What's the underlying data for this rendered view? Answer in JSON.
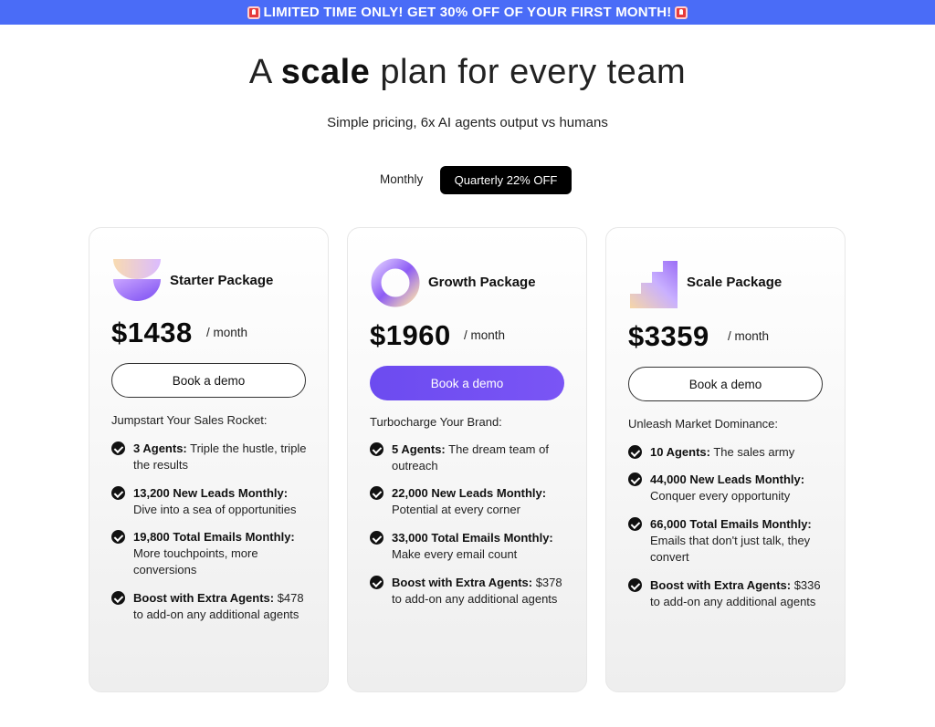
{
  "banner": {
    "text": "LIMITED TIME ONLY! GET 30% OFF OF YOUR FIRST MONTH!",
    "icon": "siren-icon",
    "background": "#4a6cf7"
  },
  "hero": {
    "title_prefix": "A ",
    "title_bold": "scale",
    "title_suffix": " plan for every team",
    "subtitle": "Simple pricing, 6x AI agents output vs humans"
  },
  "billing_toggle": {
    "monthly_label": "Monthly",
    "quarterly_label": "Quarterly 22% OFF",
    "selected": "quarterly"
  },
  "plans": [
    {
      "name": "Starter Package",
      "price": "$1438",
      "period": "/ month",
      "cta": "Book a demo",
      "tagline": "Jumpstart Your Sales Rocket:",
      "features": [
        {
          "bold": "3 Agents:",
          "text": " Triple the hustle, triple the results"
        },
        {
          "bold": "13,200 New Leads Monthly:",
          "text": " Dive into a sea of opportunities"
        },
        {
          "bold": "19,800 Total Emails Monthly:",
          "text": " More touchpoints, more conversions"
        },
        {
          "bold": "Boost with Extra Agents:",
          "text": " $478 to add-on any additional agents"
        }
      ]
    },
    {
      "name": "Growth Package",
      "price": "$1960",
      "period": "/ month",
      "cta": "Book a demo",
      "tagline": "Turbocharge Your Brand:",
      "features": [
        {
          "bold": "5 Agents:",
          "text": " The dream team of outreach"
        },
        {
          "bold": "22,000 New Leads Monthly:",
          "text": " Potential at every corner"
        },
        {
          "bold": "33,000 Total Emails Monthly:",
          "text": " Make every email count"
        },
        {
          "bold": "Boost with Extra Agents:",
          "text": " $378 to add-on any additional agents"
        }
      ]
    },
    {
      "name": "Scale Package",
      "price": "$3359",
      "period": "/ month",
      "cta": "Book a demo",
      "tagline": "Unleash Market Dominance:",
      "features": [
        {
          "bold": "10 Agents:",
          "text": " The sales army"
        },
        {
          "bold": "44,000 New Leads Monthly:",
          "text": " Conquer every opportunity"
        },
        {
          "bold": "66,000 Total Emails Monthly:",
          "text": " Emails that don't just talk, they convert"
        },
        {
          "bold": "Boost with Extra Agents:",
          "text": " $336 to add-on any additional agents"
        }
      ]
    }
  ],
  "colors": {
    "accent": "#6c4bf0",
    "toggle_active": "#000000"
  }
}
